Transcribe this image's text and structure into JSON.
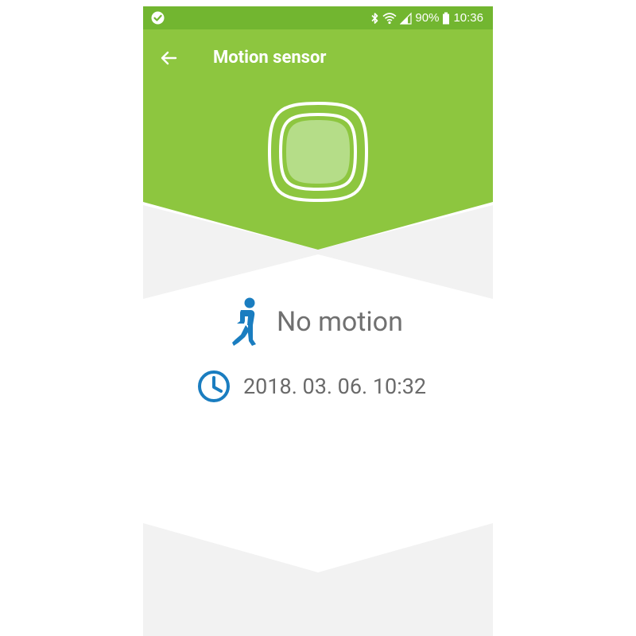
{
  "colors": {
    "primary_green": "#8DC63F",
    "status_bar_green": "#72B630",
    "accent_blue": "#1A7DC0",
    "text_gray": "#707070"
  },
  "status_bar": {
    "left_icon": "check-circle-icon",
    "icons": [
      "bluetooth-icon",
      "wifi-icon",
      "cell-signal-icon"
    ],
    "battery": "90%",
    "battery_icon": "battery-icon",
    "time": "10:36"
  },
  "app_bar": {
    "back_icon": "arrow-left-icon",
    "title": "Motion sensor"
  },
  "sensor": {
    "icon": "motion-sensor-device-icon"
  },
  "motion_status": {
    "icon": "running-person-icon",
    "text": "No motion"
  },
  "last_update": {
    "icon": "clock-icon",
    "timestamp": "2018. 03. 06. 10:32"
  }
}
